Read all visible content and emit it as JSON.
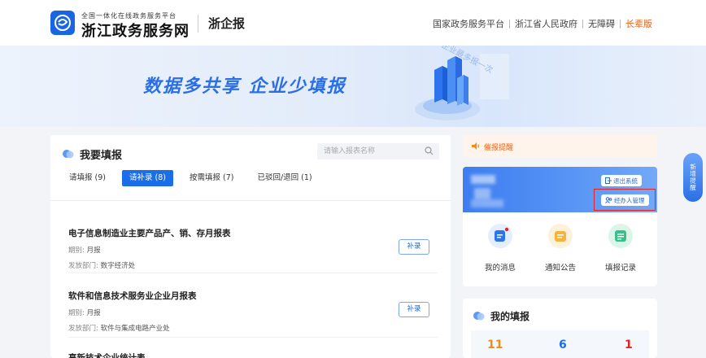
{
  "header": {
    "logo_small": "全国一体化在线政务服务平台",
    "logo_big": "浙江政务服务网",
    "sub_brand": "浙企报",
    "links": [
      "国家政务服务平台",
      "浙江省人民政府",
      "无障碍",
      "长辈版"
    ]
  },
  "banner": {
    "slogan": "数据多共享 企业少填报",
    "arc_text": "企业最多报一次"
  },
  "main": {
    "title": "我要填报",
    "search_placeholder": "请输入报表名称",
    "tabs": [
      {
        "label": "请填报 (9)",
        "active": false
      },
      {
        "label": "请补录 (8)",
        "active": true
      },
      {
        "label": "按需填报 (7)",
        "active": false
      },
      {
        "label": "已驳回/退回 (1)",
        "active": false
      }
    ],
    "reports": [
      {
        "name": "电子信息制造业主要产品产、销、存月报表",
        "period_label": "期别:",
        "period": "月报",
        "dept_label": "发放部门:",
        "dept": "数字经济处",
        "button": "补录"
      },
      {
        "name": "软件和信息技术服务业企业月报表",
        "period_label": "期别:",
        "period": "月报",
        "dept_label": "发放部门:",
        "dept": "软件与集成电路产业处",
        "button": "补录"
      },
      {
        "name": "高新技术企业统计表"
      }
    ]
  },
  "sidebar": {
    "reminder": "催报提醒",
    "logout": "退出系统",
    "agent_manage": "经办人管理",
    "quick_links": [
      {
        "label": "我的消息",
        "icon": "message-icon"
      },
      {
        "label": "通知公告",
        "icon": "notice-icon"
      },
      {
        "label": "填报记录",
        "icon": "record-icon"
      }
    ],
    "my_reports_title": "我的填报",
    "stats": [
      {
        "value": "11",
        "color": "#f08c1a"
      },
      {
        "value": "6",
        "color": "#1a6ee8"
      },
      {
        "value": "1",
        "color": "#e02424"
      }
    ]
  },
  "float_button": "新增提醒"
}
